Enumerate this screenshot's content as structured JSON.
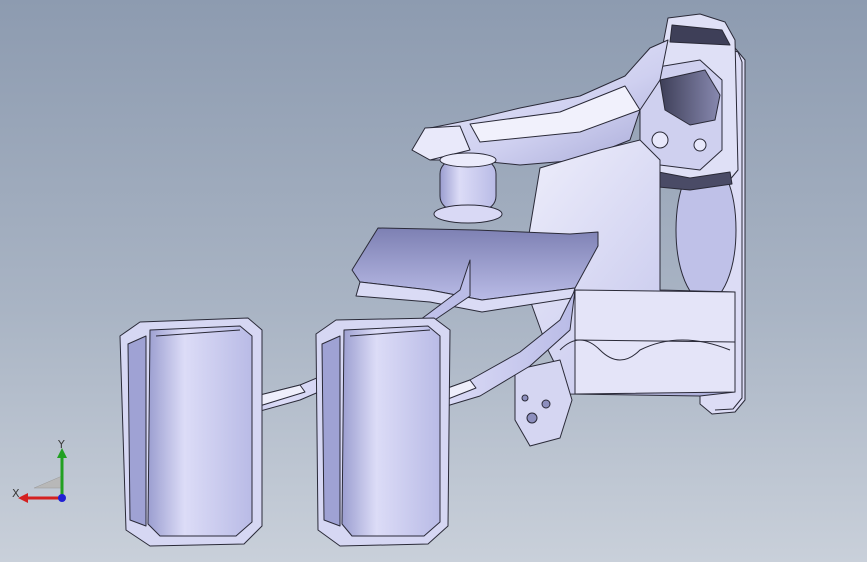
{
  "viewport": {
    "background_top": "#8d9bb0",
    "background_bottom": "#c9d0da"
  },
  "model": {
    "fill_color": "#c7c8ee",
    "highlight_color": "#ecebfb",
    "shadow_color": "#7b7fa8",
    "edge_color": "#2a2a38"
  },
  "triad": {
    "x_label": "X",
    "y_label": "Y",
    "x_color": "#d42020",
    "y_color": "#22a022",
    "z_color": "#2020d4"
  }
}
